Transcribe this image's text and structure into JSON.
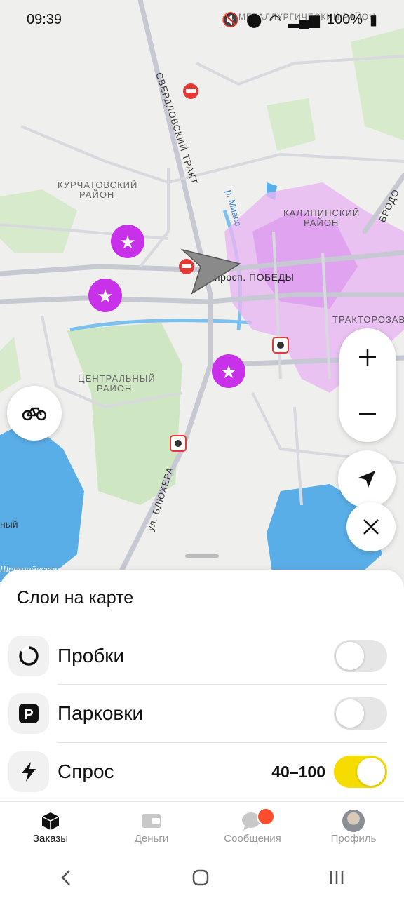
{
  "status_bar": {
    "time": "09:39",
    "battery": "100%"
  },
  "map": {
    "labels": {
      "sverdlovsky_trakt": "СВЕРДЛОВСКИЙ ТРАКТ",
      "kurchatovsky_1": "КУРЧАТОВСКИЙ",
      "kurchatovsky_2": "РАЙОН",
      "kalininsky_1": "КАЛИНИНСКИЙ",
      "kalininsky_2": "РАЙОН",
      "tsentralny_1": "ЦЕНТРАЛЬНЫЙ",
      "tsentralny_2": "РАЙОН",
      "prosp_pobedy": "просп. ПОБЕДЫ",
      "traktorozavod": "ТРАКТОРОЗАВО",
      "blyukhera": "ул. БЛЮХЕРА",
      "river": "р. Миасс",
      "brodo": "БРОДО",
      "ny": "ный",
      "sovetsky_top": "МЕТАЛЛУРГИЧЕСКИЙ РАЙОН",
      "shershni": "Шершнёвское"
    }
  },
  "layers_sheet": {
    "title": "Слои на карте",
    "items": [
      {
        "label": "Пробки",
        "value": "",
        "enabled": false
      },
      {
        "label": "Парковки",
        "value": "",
        "enabled": false
      },
      {
        "label": "Спрос",
        "value": "40–100",
        "enabled": true
      }
    ]
  },
  "tabs": [
    {
      "label": "Заказы",
      "active": true
    },
    {
      "label": "Деньги",
      "active": false
    },
    {
      "label": "Сообщения",
      "active": false
    },
    {
      "label": "Профиль",
      "active": false
    }
  ],
  "colors": {
    "accent": "#f7dc00",
    "demand": "#d44df0",
    "badge": "#ff4d2e"
  }
}
